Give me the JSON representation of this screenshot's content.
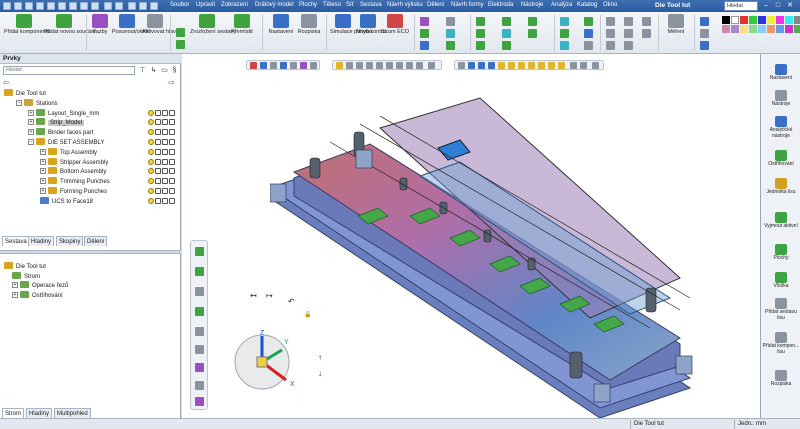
{
  "window": {
    "doc_title": "Die Tool tut",
    "search_placeholder": "Hledat",
    "minimize": "–",
    "maximize": "□",
    "close": "✕"
  },
  "menu": [
    "Soubor",
    "Upravit",
    "Zobrazení",
    "Drátový model",
    "Plochy",
    "Těleso",
    "Síť",
    "Sestava",
    "Návrh výlisku",
    "Dělení",
    "Návrh formy",
    "Elektroda",
    "Nástroje",
    "Analýza",
    "Katalog",
    "Okno"
  ],
  "ribbon": {
    "add_component": "Přidat komponentu",
    "add_new_part": "Přidat novou součást",
    "constraints": "Vazby",
    "move_rotate": "Posunout/otočit",
    "activate_main": "Aktivovat hlavní...",
    "explode": "Zrozložení sestavy",
    "relocate": "Přemístit",
    "settings": "Nastavení",
    "spread": "Rozpiska",
    "simulate": "Simulace pohybu",
    "new_control": "Nová kontro...",
    "eco_tree": "Strom ECO",
    "measure": "Měření"
  },
  "left_panel": {
    "title": "Prvky",
    "filter_placeholder": "Hledat",
    "tree": [
      {
        "label": "Die Tool tut",
        "depth": 0,
        "expand": "",
        "icon": "assembly-icon"
      },
      {
        "label": "Stations",
        "depth": 1,
        "expand": "−",
        "icon": "folder-icon"
      },
      {
        "label": "Layout_Single_mm",
        "depth": 2,
        "expand": "+",
        "icon": "part-icon"
      },
      {
        "label": "Strip_Model",
        "depth": 2,
        "expand": "+",
        "icon": "part-icon",
        "selected": true
      },
      {
        "label": "Binder faces part",
        "depth": 2,
        "expand": "+",
        "icon": "part-icon"
      },
      {
        "label": "DIE SET ASSEMBLY",
        "depth": 2,
        "expand": "−",
        "icon": "assembly-icon"
      },
      {
        "label": "Top Assembly",
        "depth": 3,
        "expand": "+",
        "icon": "assembly-icon"
      },
      {
        "label": "Stripper Assembly",
        "depth": 3,
        "expand": "+",
        "icon": "assembly-icon"
      },
      {
        "label": "Bottom Assembly",
        "depth": 3,
        "expand": "+",
        "icon": "assembly-icon"
      },
      {
        "label": "Trimming Punches",
        "depth": 3,
        "expand": "+",
        "icon": "assembly-icon"
      },
      {
        "label": "Forming Punches",
        "depth": 3,
        "expand": "+",
        "icon": "assembly-icon"
      },
      {
        "label": "UCS to Face18",
        "depth": 3,
        "expand": "",
        "icon": "ucs-icon"
      }
    ],
    "tabs_top": [
      "Sestava",
      "Hladiny",
      "Skupiny",
      "Dělení"
    ],
    "tree2": [
      {
        "label": "Die Tool tut",
        "depth": 0,
        "expand": ""
      },
      {
        "label": "Strom",
        "depth": 1,
        "expand": ""
      },
      {
        "label": "Operace řezů",
        "depth": 1,
        "expand": "+"
      },
      {
        "label": "Ostřihování",
        "depth": 1,
        "expand": "+"
      }
    ],
    "tabs_bottom": [
      "Strom",
      "Hladiny",
      "Multipohled"
    ]
  },
  "right_panel": [
    {
      "label": "Nastavení",
      "icon": "settings-icon"
    },
    {
      "label": "Nástroje",
      "icon": "tools-icon"
    },
    {
      "label": "Analytické nástroje",
      "icon": "analysis-icon"
    },
    {
      "label": "Ostřihování",
      "icon": "trim-icon"
    },
    {
      "label": "Jednotka lisu",
      "icon": "press-icon"
    },
    {
      "label": "Vyjmout aktivní",
      "icon": "extract-icon"
    },
    {
      "label": "Plochy",
      "icon": "surface-icon"
    },
    {
      "label": "Vložka",
      "icon": "insert-icon"
    },
    {
      "label": "Přidat sestavu lisu",
      "icon": "add-press-icon"
    },
    {
      "label": "Přidat kompon... lisu",
      "icon": "add-comp-icon"
    },
    {
      "label": "Rozpiska",
      "icon": "bom-icon"
    }
  ],
  "triad": {
    "x": "X",
    "y": "Y",
    "z": "Z"
  },
  "status": {
    "doc": "Die Tool tut",
    "units": "Jedn.: mm"
  },
  "colors": {
    "accent": "#2a5aa0",
    "selection": "#c7c9cc",
    "green": "#3fa33f"
  }
}
